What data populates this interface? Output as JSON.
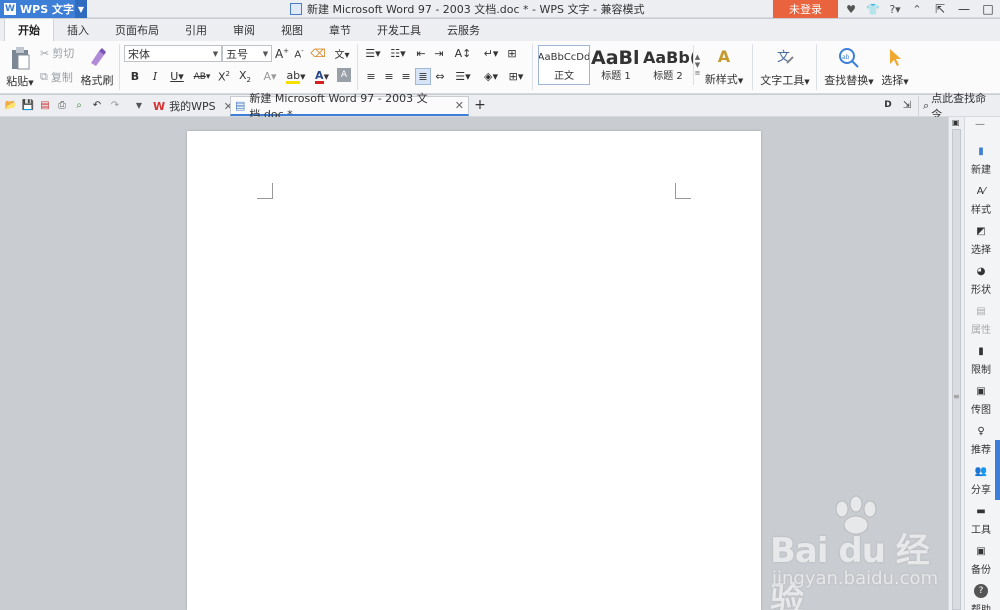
{
  "app": {
    "menu_label": "WPS 文字",
    "window_title": "新建 Microsoft Word 97 - 2003 文档.doc * - WPS 文字 - 兼容模式",
    "login_label": "未登录"
  },
  "ribbon_tabs": [
    "开始",
    "插入",
    "页面布局",
    "引用",
    "审阅",
    "视图",
    "章节",
    "开发工具",
    "云服务"
  ],
  "clipboard": {
    "paste": "粘贴",
    "cut": "剪切",
    "copy": "复制",
    "format_painter": "格式刷"
  },
  "font": {
    "name": "宋体",
    "size": "五号"
  },
  "styles": [
    {
      "sample": "AaBbCcDd",
      "label": "正文"
    },
    {
      "sample": "AaBl",
      "label": "标题 1"
    },
    {
      "sample": "AaBb(",
      "label": "标题 2"
    }
  ],
  "ribbon_buttons": {
    "new_style": "新样式",
    "text_tools": "文字工具",
    "find_replace": "查找替换",
    "select": "选择"
  },
  "doc_tabs": [
    {
      "label": "我的WPS"
    },
    {
      "label": "新建 Microsoft Word 97 - 2003 文档.doc *"
    }
  ],
  "search_command": "点此查找命令",
  "task_pane": [
    "新建",
    "样式",
    "选择",
    "形状",
    "属性",
    "限制",
    "传图",
    "推荐",
    "分享",
    "工具",
    "备份",
    "帮助"
  ],
  "watermark": {
    "brand": "Bai du 经验",
    "url": "jingyan.baidu.com"
  },
  "colors": {
    "accent": "#3d7fd6",
    "login_bg": "#e8633e",
    "highlight": "#f5e100",
    "font_color": "#d62020"
  }
}
